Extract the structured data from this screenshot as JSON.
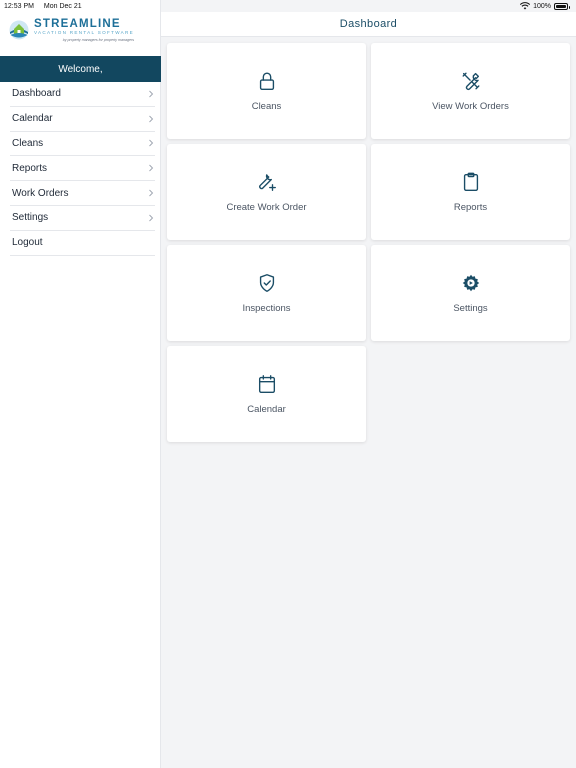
{
  "status_bar": {
    "time": "12:53 PM",
    "date": "Mon Dec 21",
    "battery": "100%",
    "wifi_icon": "wifi-icon",
    "battery_icon": "battery-icon",
    "battery_level": 1.0
  },
  "brand": {
    "title": "STREAMLINE",
    "subtitle": "VACATION RENTAL SOFTWARE",
    "tagline": "by property managers for property managers",
    "logo_icon": "house-globe-logo",
    "colors": {
      "primary": "#1d6f98",
      "light": "#5aa7c9",
      "green": "#7bbf3a"
    }
  },
  "sidebar": {
    "welcome": "Welcome,",
    "welcome_bg": "#12475f",
    "items": [
      {
        "label": "Dashboard",
        "chevron": true
      },
      {
        "label": "Calendar",
        "chevron": true
      },
      {
        "label": "Cleans",
        "chevron": true
      },
      {
        "label": "Reports",
        "chevron": true
      },
      {
        "label": "Work Orders",
        "chevron": true
      },
      {
        "label": "Settings",
        "chevron": true
      },
      {
        "label": "Logout",
        "chevron": false
      }
    ]
  },
  "header": {
    "title": "Dashboard"
  },
  "tiles": [
    {
      "label": "Cleans",
      "icon": "lock-icon"
    },
    {
      "label": "View Work Orders",
      "icon": "tools-icon"
    },
    {
      "label": "Create Work Order",
      "icon": "wrench-plus-icon"
    },
    {
      "label": "Reports",
      "icon": "clipboard-icon"
    },
    {
      "label": "Inspections",
      "icon": "shield-check-icon"
    },
    {
      "label": "Settings",
      "icon": "gear-icon"
    },
    {
      "label": "Calendar",
      "icon": "calendar-icon"
    }
  ],
  "accent_color": "#1b4d66"
}
